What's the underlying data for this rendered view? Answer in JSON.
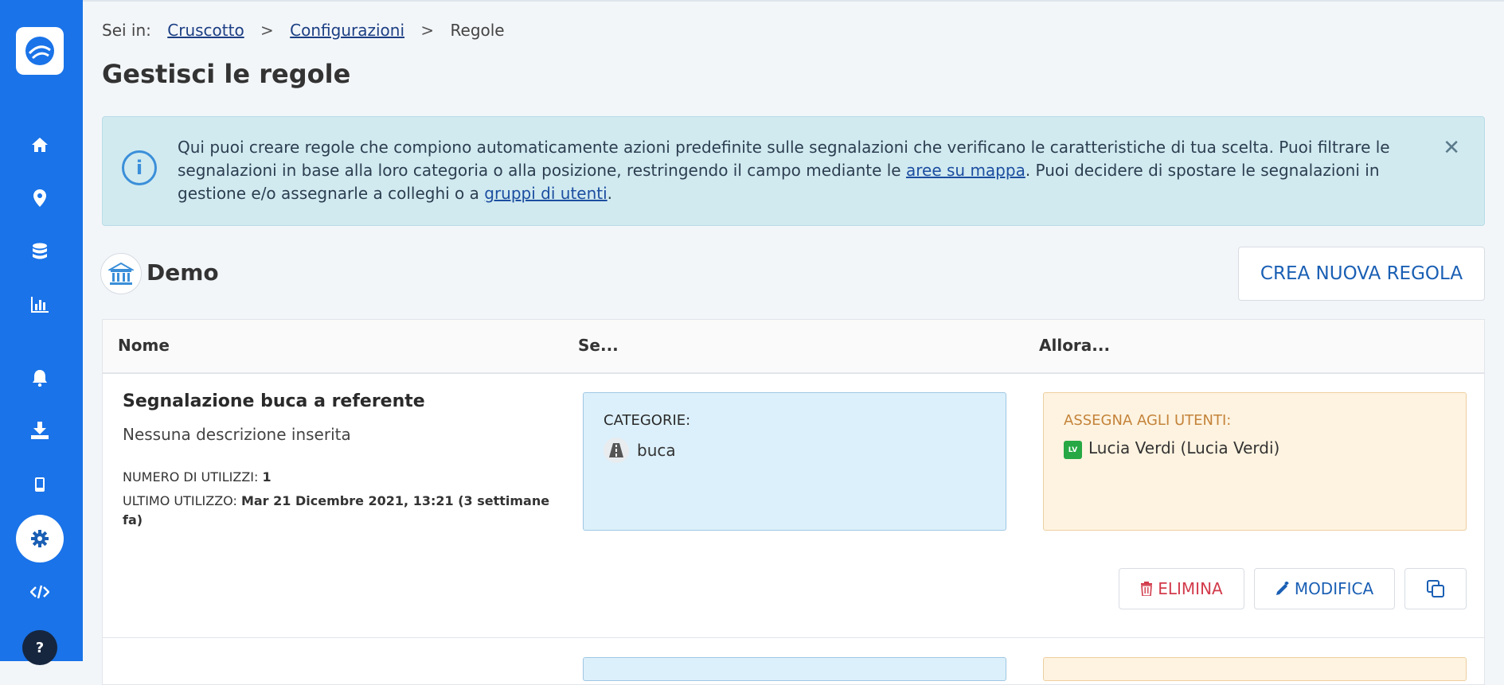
{
  "breadcrumb": {
    "prefix": "Sei in:",
    "items": [
      "Cruscotto",
      "Configurazioni",
      "Regole"
    ],
    "separator": ">"
  },
  "page": {
    "title": "Gestisci le regole"
  },
  "info": {
    "text_1": "Qui puoi creare regole che compiono automaticamente azioni predefinite sulle segnalazioni che verificano le caratteristiche di tua scelta. Puoi filtrare le segnalazioni in base alla loro categoria o alla posizione, restringendo il campo mediante le ",
    "link_1": "aree su mappa",
    "text_2": ". Puoi decidere di spostare le segnalazioni in gestione e/o assegnarle a colleghi o a ",
    "link_2": "gruppi di utenti",
    "text_3": ".",
    "close": "✕"
  },
  "group": {
    "name": "Demo",
    "create_label": "CREA NUOVA REGOLA"
  },
  "table": {
    "headers": [
      "Nome",
      "Se...",
      "Allora..."
    ],
    "rows": [
      {
        "name": "Segnalazione buca a referente",
        "description": "Nessuna descrizione inserita",
        "uses_label": "NUMERO DI UTILIZZI:",
        "uses_value": "1",
        "last_use_label": "ULTIMO UTILIZZO:",
        "last_use_value": "Mar 21 Dicembre 2021, 13:21 (3 settimane fa)",
        "condition_title": "CATEGORIE:",
        "condition_category": "buca",
        "action_title": "ASSEGNA AGLI UTENTI:",
        "action_user_initials": "LV",
        "action_user": "Lucia Verdi (Lucia Verdi)",
        "delete_label": "ELIMINA",
        "edit_label": "MODIFICA"
      }
    ]
  },
  "sidebar": {
    "help_label": "?",
    "icons": [
      "logo-icon",
      "home-icon",
      "map-pin-icon",
      "database-icon",
      "chart-icon",
      "bell-icon",
      "download-icon",
      "mobile-icon",
      "gear-icon",
      "code-icon",
      "help-icon"
    ]
  },
  "colors": {
    "sidebar": "#1a73e8",
    "info_bg": "#d1eaf0",
    "condition_bg": "#dcf0fb",
    "action_bg": "#fef3e0",
    "danger": "#d23b4b",
    "primary": "#1a5fb4"
  }
}
